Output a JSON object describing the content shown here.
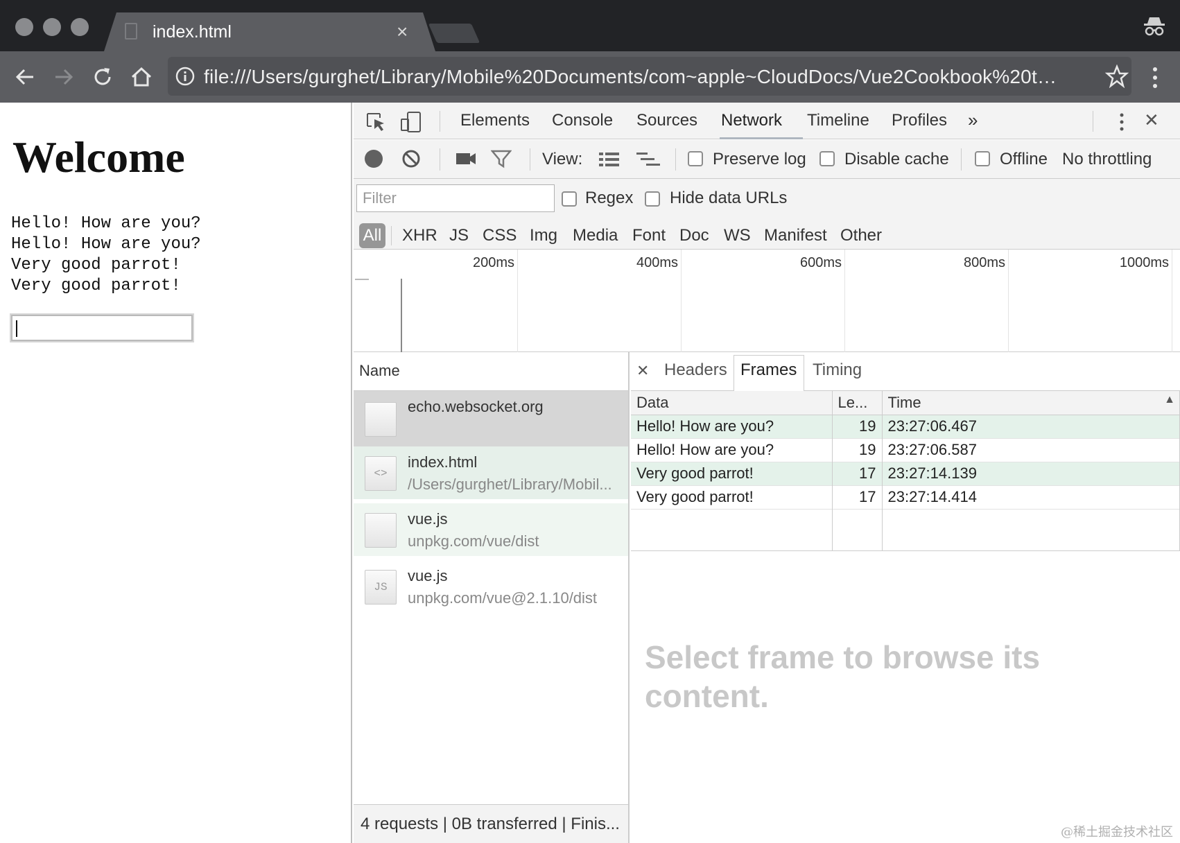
{
  "browser": {
    "tab_title": "index.html",
    "tab_close": "×",
    "url": "file:///Users/gurghet/Library/Mobile%20Documents/com~apple~CloudDocs/Vue2Cookbook%20to..."
  },
  "page": {
    "heading": "Welcome",
    "messages": [
      "Hello! How are you?",
      "Hello! How are you?",
      "Very good parrot!",
      "Very good parrot!"
    ],
    "input_value": ""
  },
  "devtools": {
    "tabs": [
      "Elements",
      "Console",
      "Sources",
      "Network",
      "Timeline",
      "Profiles"
    ],
    "active_tab": "Network",
    "more": "»",
    "close": "✕",
    "toolbar": {
      "view_label": "View:",
      "preserve_log": "Preserve log",
      "disable_cache": "Disable cache",
      "offline": "Offline",
      "throttling": "No throttling"
    },
    "filter": {
      "placeholder": "Filter",
      "regex": "Regex",
      "hide_data_urls": "Hide data URLs",
      "types": [
        "All",
        "XHR",
        "JS",
        "CSS",
        "Img",
        "Media",
        "Font",
        "Doc",
        "WS",
        "Manifest",
        "Other"
      ]
    },
    "overview_ticks": [
      "200ms",
      "400ms",
      "600ms",
      "800ms",
      "1000ms"
    ],
    "requests": {
      "header": "Name",
      "items": [
        {
          "name": "echo.websocket.org",
          "path": "",
          "icon": ""
        },
        {
          "name": "index.html",
          "path": "/Users/gurghet/Library/Mobil...",
          "icon": "<>"
        },
        {
          "name": "vue.js",
          "path": "unpkg.com/vue/dist",
          "icon": ""
        },
        {
          "name": "vue.js",
          "path": "unpkg.com/vue@2.1.10/dist",
          "icon": "JS"
        }
      ],
      "status": "4 requests | 0B transferred | Finis..."
    },
    "detail": {
      "close": "✕",
      "tabs": [
        "Headers",
        "Frames",
        "Timing"
      ],
      "active_tab": "Frames",
      "columns": [
        "Data",
        "Le...",
        "Time"
      ],
      "sort_indicator": "▲",
      "frames": [
        {
          "data": "Hello! How are you?",
          "length": "19",
          "time": "23:27:06.467",
          "sent": true
        },
        {
          "data": "Hello! How are you?",
          "length": "19",
          "time": "23:27:06.587",
          "sent": false
        },
        {
          "data": "Very good parrot!",
          "length": "17",
          "time": "23:27:14.139",
          "sent": true
        },
        {
          "data": "Very good parrot!",
          "length": "17",
          "time": "23:27:14.414",
          "sent": false
        }
      ],
      "empty_message": "Select frame to browse its content."
    }
  },
  "watermark": "@稀土掘金技术社区",
  "colors": {
    "sent_row": "#e4f2ea",
    "titlebar": "#222326",
    "toolbar": "#5c5d61"
  }
}
